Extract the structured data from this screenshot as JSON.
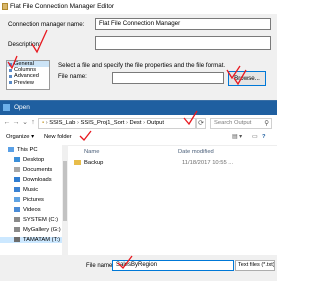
{
  "editor": {
    "title": "Flat File Connection Manager Editor",
    "connection_manager_name_label": "Connection manager name:",
    "connection_manager_name_value": "Flat File Connection Manager",
    "description_label": "Description:",
    "description_value": "",
    "nav_items": [
      "General",
      "Columns",
      "Advanced",
      "Preview"
    ],
    "instruction": "Select a file and specify the file properties and the file format.",
    "file_name_label": "File name:",
    "file_name_value": "",
    "browse_label": "Browse..."
  },
  "open_dialog": {
    "title": "Open",
    "breadcrumb": [
      "SSIS_Lab",
      "SSIS_Proj1_Sort",
      "Dest",
      "Output"
    ],
    "search_placeholder": "Search Output",
    "organize_label": "Organize",
    "new_folder_label": "New folder",
    "nav_tree": [
      {
        "label": "This PC",
        "icon": "pc-icon"
      },
      {
        "label": "Desktop",
        "icon": "desktop-icon"
      },
      {
        "label": "Documents",
        "icon": "documents-icon"
      },
      {
        "label": "Downloads",
        "icon": "downloads-icon"
      },
      {
        "label": "Music",
        "icon": "music-icon"
      },
      {
        "label": "Pictures",
        "icon": "pictures-icon"
      },
      {
        "label": "Videos",
        "icon": "videos-icon"
      },
      {
        "label": "SYSTEM (C:)",
        "icon": "drive-icon"
      },
      {
        "label": "MyGallery (G:)",
        "icon": "drive-icon"
      },
      {
        "label": "TAMATAM (T:)",
        "icon": "drive-icon"
      }
    ],
    "columns": {
      "name": "Name",
      "date_modified": "Date modified"
    },
    "files": [
      {
        "name": "Backup",
        "date_modified": "11/18/2017 10:55 ..."
      }
    ],
    "file_name_label": "File name:",
    "file_name_value": "SalesByRegion",
    "file_type_value": "Text files (*.txt)"
  },
  "colors": {
    "accent": "#0078d7",
    "annotation": "#e8181f",
    "dialog_title": "#1f5fa0",
    "selection": "#cce8ff"
  }
}
